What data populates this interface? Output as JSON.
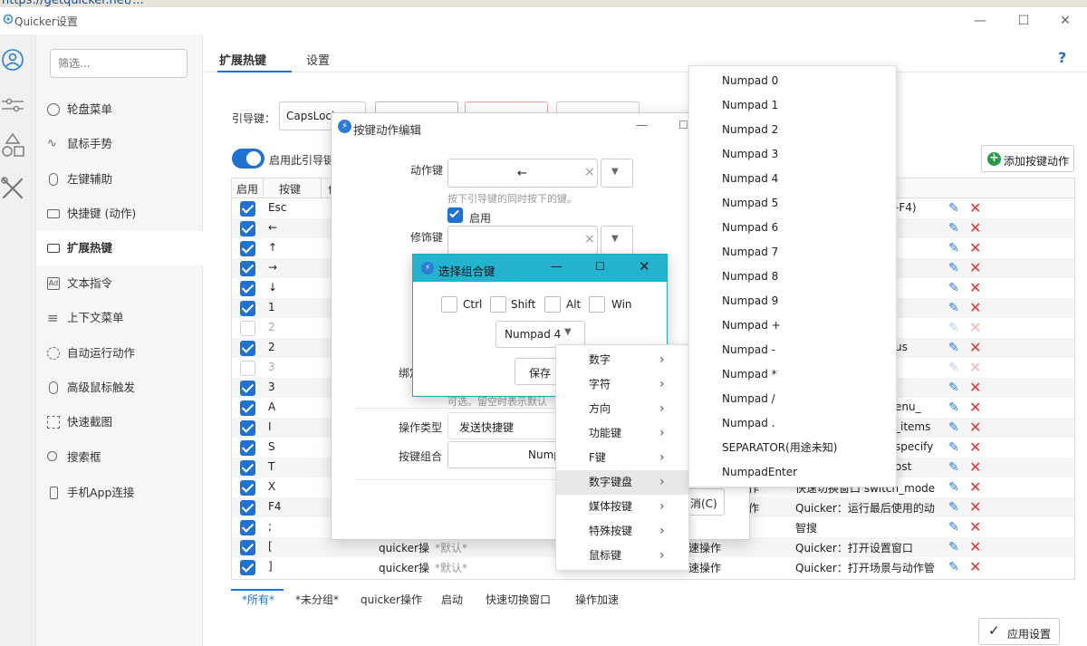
{
  "browser": {
    "url": "https://getquicker.net/..."
  },
  "window": {
    "title": "Quicker设置",
    "controls": [
      "—",
      "☐",
      "✕"
    ]
  },
  "nav": {
    "filter_placeholder": "筛选...",
    "items": [
      {
        "label": "轮盘菜单",
        "icon": "wheel-icon"
      },
      {
        "label": "鼠标手势",
        "icon": "gesture-icon"
      },
      {
        "label": "左键辅助",
        "icon": "mouse-icon"
      },
      {
        "label": "快捷键 (动作)",
        "icon": "keyboard-icon"
      },
      {
        "label": "扩展热键",
        "icon": "keyboard-icon",
        "active": true
      },
      {
        "label": "文本指令",
        "icon": "ad-icon"
      },
      {
        "label": "上下文菜单",
        "icon": "menu-icon"
      },
      {
        "label": "自动运行动作",
        "icon": "clock-icon"
      },
      {
        "label": "高级鼠标触发",
        "icon": "mouse-icon"
      },
      {
        "label": "快速截图",
        "icon": "screenshot-icon"
      },
      {
        "label": "搜索框",
        "icon": "search-icon"
      },
      {
        "label": "手机App连接",
        "icon": "phone-icon"
      }
    ]
  },
  "tabs": [
    {
      "label": "扩展热键",
      "active": true
    },
    {
      "label": "设置"
    }
  ],
  "help": "?",
  "leader": {
    "label": "引导键：",
    "value": "CapsLock"
  },
  "enable_leader": "启用此引导键",
  "add_action": "添加按键动作",
  "table": {
    "headers": [
      "启用",
      "按键",
      "作"
    ],
    "rows": [
      {
        "on": true,
        "key": "Esc",
        "desc": "-F4)"
      },
      {
        "on": true,
        "key": "←",
        "desc": ""
      },
      {
        "on": true,
        "key": "↑",
        "desc": ""
      },
      {
        "on": true,
        "key": "→",
        "desc": ""
      },
      {
        "on": true,
        "key": "↓",
        "desc": ""
      },
      {
        "on": true,
        "key": "1",
        "desc": ""
      },
      {
        "on": false,
        "key": "2",
        "desc": ""
      },
      {
        "on": true,
        "key": "2",
        "desc": "us"
      },
      {
        "on": false,
        "key": "3",
        "desc": ""
      },
      {
        "on": true,
        "key": "3",
        "desc": ""
      },
      {
        "on": true,
        "key": "A",
        "desc": "enu_"
      },
      {
        "on": true,
        "key": "I",
        "desc": "_items"
      },
      {
        "on": true,
        "key": "S",
        "desc": "specify"
      },
      {
        "on": true,
        "key": "T",
        "desc": "ost"
      },
      {
        "on": true,
        "key": "X",
        "desc": "快速切换窗口 switch_mode"
      },
      {
        "on": true,
        "key": "F4",
        "desc": "Quicker：运行最后使用的动"
      },
      {
        "on": true,
        "key": ";",
        "desc": "智搜"
      },
      {
        "on": true,
        "key": "[",
        "group": "quicker操",
        "default": "*默认*",
        "type": "速操作",
        "desc": "Quicker：打开设置窗口"
      },
      {
        "on": true,
        "key": "]",
        "group": "quicker操",
        "default": "*默认*",
        "type": "速操作",
        "desc": "Quicker：打开场景与动作管"
      }
    ],
    "type_col_row15": "作",
    "type_col_row16": "作"
  },
  "groups": [
    "*所有*",
    "*未分组*",
    "quicker操作",
    "启动",
    "快速切换窗口",
    "操作加速"
  ],
  "apply": "应用设置",
  "editor": {
    "title": "按键动作编辑",
    "action_key_label": "动作键",
    "action_key_value": "←",
    "action_key_hint": "按下引导键的同时按下的键。",
    "enabled": "启用",
    "modifier_label": "修饰键",
    "bind_label": "绑定",
    "bind_hint": "可选。留空时表示默认",
    "op_type_label": "操作类型",
    "op_type_value": "发送快捷键",
    "combo_label": "按键组合",
    "combo_value": "Nump",
    "cancel": "消(C)"
  },
  "combo_dialog": {
    "title": "选择组合键",
    "modifiers": [
      "Ctrl",
      "Shift",
      "Alt",
      "Win"
    ],
    "key": "Numpad 4",
    "save": "保存"
  },
  "category_menu": [
    "数字",
    "字符",
    "方向",
    "功能键",
    "F键",
    "数字键盘",
    "媒体按键",
    "特殊按键",
    "鼠标键"
  ],
  "category_highlight": "数字键盘",
  "numpad_menu": [
    "Numpad 0",
    "Numpad 1",
    "Numpad 2",
    "Numpad 3",
    "Numpad 4",
    "Numpad 5",
    "Numpad 6",
    "Numpad 7",
    "Numpad 8",
    "Numpad 9",
    "Numpad +",
    "Numpad -",
    "Numpad *",
    "Numpad /",
    "Numpad .",
    "SEPARATOR(用途未知)",
    "NumpadEnter"
  ],
  "colors": {
    "accent": "#1e72d4",
    "combo_titlebar": "#23b3cf",
    "delete": "#e53333"
  }
}
